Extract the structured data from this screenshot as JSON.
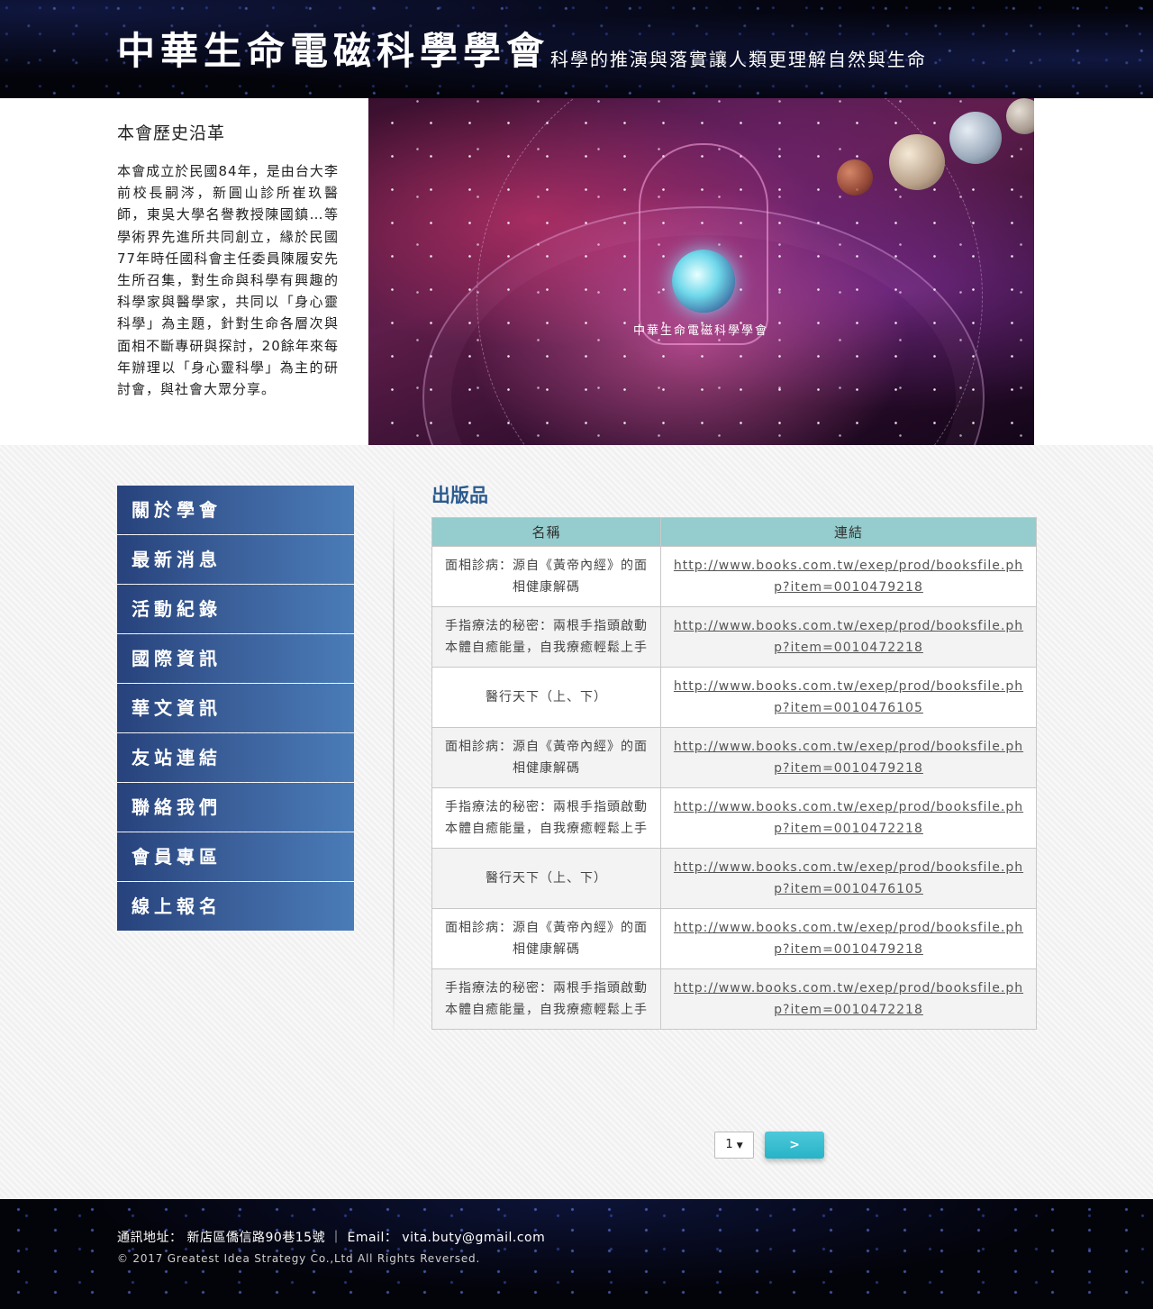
{
  "header": {
    "site_title": "中華生命電磁科學學會",
    "tagline": "科學的推演與落實讓人類更理解自然與生命"
  },
  "intro": {
    "title": "本會歷史沿革",
    "text": "本會成立於民國84年，是由台大李前校長嗣涔，新圓山診所崔玖醫師，東吳大學名譽教授陳國鎮…等學術界先進所共同創立，緣於民國77年時任國科會主任委員陳履安先生所召集，對生命與科學有興趣的科學家與醫學家，共同以「身心靈科學」為主題，針對生命各層次與面相不斷專研與探討，20餘年來每年辦理以「身心靈科學」為主的研討會，與社會大眾分享。",
    "hero_caption": "中華生命電磁科學學會"
  },
  "sidebar": {
    "items": [
      {
        "label": "關於學會"
      },
      {
        "label": "最新消息"
      },
      {
        "label": "活動紀錄"
      },
      {
        "label": "國際資訊"
      },
      {
        "label": "華文資訊"
      },
      {
        "label": "友站連結"
      },
      {
        "label": "聯絡我們"
      },
      {
        "label": "會員專區"
      },
      {
        "label": "線上報名"
      }
    ]
  },
  "main": {
    "section_title": "出版品",
    "table": {
      "headers": [
        "名稱",
        "連結"
      ],
      "rows": [
        {
          "name": "面相診病：源自《黃帝內經》的面相健康解碼",
          "link": "http://www.books.com.tw/exep/prod/booksfile.php?item=0010479218"
        },
        {
          "name": "手指療法的秘密：兩根手指頭啟動本體自癒能量，自我療癒輕鬆上手",
          "link": "http://www.books.com.tw/exep/prod/booksfile.php?item=0010472218"
        },
        {
          "name": "醫行天下（上、下）",
          "link": "http://www.books.com.tw/exep/prod/booksfile.php?item=0010476105"
        },
        {
          "name": "面相診病：源自《黃帝內經》的面相健康解碼",
          "link": "http://www.books.com.tw/exep/prod/booksfile.php?item=0010479218"
        },
        {
          "name": "手指療法的秘密：兩根手指頭啟動本體自癒能量，自我療癒輕鬆上手",
          "link": "http://www.books.com.tw/exep/prod/booksfile.php?item=0010472218"
        },
        {
          "name": "醫行天下（上、下）",
          "link": "http://www.books.com.tw/exep/prod/booksfile.php?item=0010476105"
        },
        {
          "name": "面相診病：源自《黃帝內經》的面相健康解碼",
          "link": "http://www.books.com.tw/exep/prod/booksfile.php?item=0010479218"
        },
        {
          "name": "手指療法的秘密：兩根手指頭啟動本體自癒能量，自我療癒輕鬆上手",
          "link": "http://www.books.com.tw/exep/prod/booksfile.php?item=0010472218"
        }
      ]
    },
    "pagination": {
      "page_value": "1",
      "next_label": ">"
    }
  },
  "footer": {
    "address_label": "通訊地址：",
    "address": "新店區僑信路90巷15號",
    "email_label": "Email：",
    "email": "vita.buty@gmail.com",
    "copyright": "© 2017 Greatest Idea Strategy Co.,Ltd All Rights Reversed."
  }
}
